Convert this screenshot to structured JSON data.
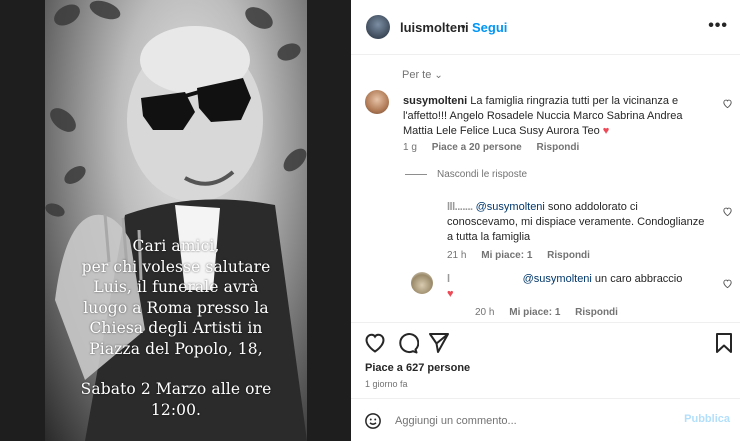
{
  "media": {
    "overlay_lines": [
      "Cari amici,",
      "per chi volesse salutare",
      "Luis, il funerale avrà",
      "luogo a Roma presso la",
      "Chiesa degli Artisti in",
      "Piazza del Popolo, 18,",
      "",
      "Sabato 2 Marzo alle ore",
      "12:00."
    ]
  },
  "header": {
    "username": "luismolteni",
    "separator": "•",
    "follow_label": "Segui",
    "more_icon": "more-horizontal-icon"
  },
  "comments": {
    "filter_label": "Per te",
    "main": {
      "username": "susymolteni",
      "text": "La famiglia ringrazia tutti per la vicinanza e l'affetto!!! Angelo Rosadele Nuccia Marco Sabrina Andrea Mattia Lele Felice Luca Susy Aurora Teo",
      "emoji": "♥",
      "time": "1 g",
      "likes": "Piace a 20 persone",
      "reply_label": "Rispondi"
    },
    "hide_replies_label": "Nascondi le risposte",
    "replies": [
      {
        "username": "lll.......",
        "mention": "@susymolteni",
        "text": " sono addolorato ci conoscevamo, mi dispiace veramente. Condoglianze a tutta la famiglia",
        "time": "21 h",
        "likes": "Mi piace: 1",
        "reply_label": "Rispondi"
      },
      {
        "username": "l",
        "mention": "@susymolteni",
        "text": " un caro abbraccio",
        "emoji": "♥",
        "time": "20 h",
        "likes": "Mi piace: 1",
        "reply_label": "Rispondi"
      }
    ]
  },
  "actions": {
    "likes_text": "Piace a 627 persone",
    "time_text": "1 giorno fa"
  },
  "add_comment": {
    "placeholder": "Aggiungi un commento...",
    "publish_label": "Pubblica"
  },
  "colors": {
    "accent": "#0095f6",
    "heart": "#ed4956",
    "publish_disabled": "#b2dffc"
  }
}
